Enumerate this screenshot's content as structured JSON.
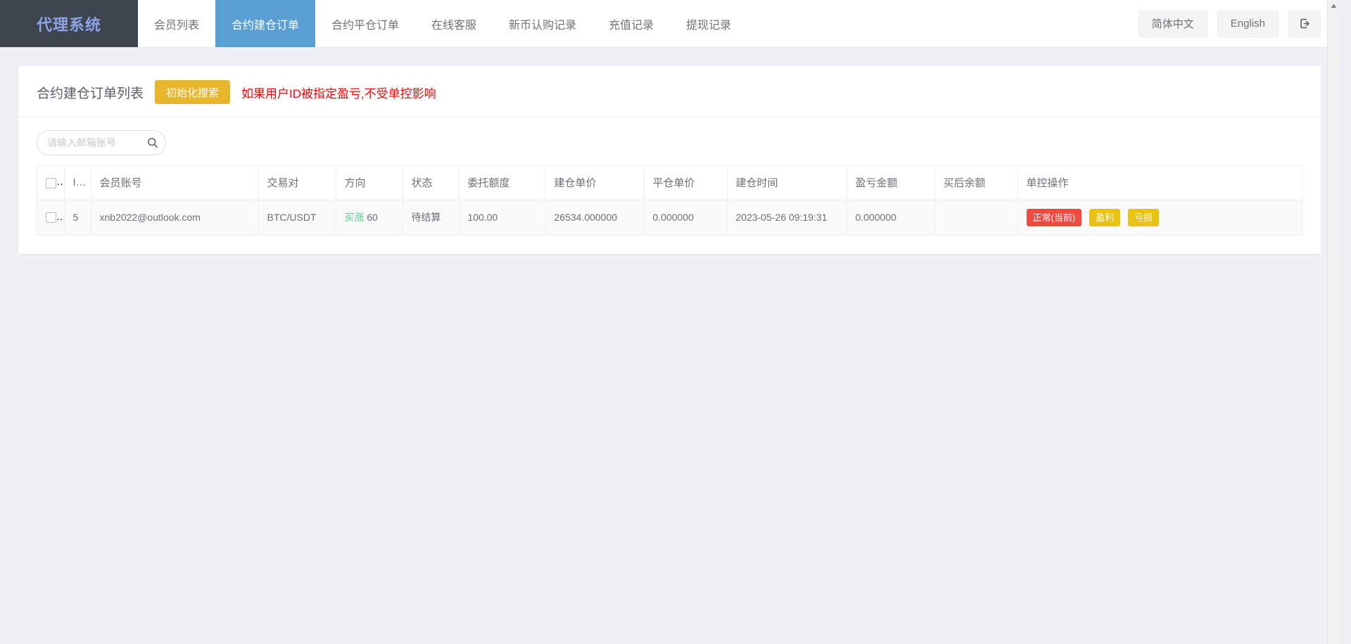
{
  "header": {
    "brand": "代理系统",
    "nav": [
      {
        "label": "会员列表",
        "active": false
      },
      {
        "label": "合约建仓订单",
        "active": true
      },
      {
        "label": "合约平仓订单",
        "active": false
      },
      {
        "label": "在线客服",
        "active": false
      },
      {
        "label": "新币认购记录",
        "active": false
      },
      {
        "label": "充值记录",
        "active": false
      },
      {
        "label": "提现记录",
        "active": false
      }
    ],
    "lang_zh": "简体中文",
    "lang_en": "English",
    "logout_icon": "logout-icon"
  },
  "page": {
    "title": "合约建仓订单列表",
    "init_search_label": "初始化搜索",
    "warning": "如果用户ID被指定盈亏,不受单控影响"
  },
  "search": {
    "placeholder": "请输入邮箱账号",
    "value": "",
    "icon": "search-icon"
  },
  "table": {
    "columns": [
      "ID",
      "会员账号",
      "交易对",
      "方向",
      "状态",
      "委托额度",
      "建仓单价",
      "平仓单价",
      "建仓时间",
      "盈亏金额",
      "买后余额",
      "单控操作"
    ],
    "rows": [
      {
        "id": "5",
        "account": "xnb2022@outlook.com",
        "pair": "BTC/USDT",
        "direction": "买涨",
        "direction_amount": "60",
        "status": "待结算",
        "quota": "100.00",
        "open_price": "26534.000000",
        "close_price": "0.000000",
        "open_time": "2023-05-26 09:19:31",
        "pnl": "0.000000",
        "balance_after": "",
        "ops": [
          {
            "label": "正常(当前)",
            "style": "danger"
          },
          {
            "label": "盈利",
            "style": "warn"
          },
          {
            "label": "亏损",
            "style": "warn"
          }
        ]
      }
    ]
  },
  "colors": {
    "brand_dark": "#3e444e",
    "brand_text": "#8ea4e8",
    "accent_blue": "#5a9fd4",
    "warn_yellow": "#e8b62c",
    "danger_red": "#f0493f",
    "op_yellow": "#e8c312",
    "up_green": "#5cc98c",
    "page_bg": "#eef0f5",
    "alert_red": "#ff0000"
  }
}
